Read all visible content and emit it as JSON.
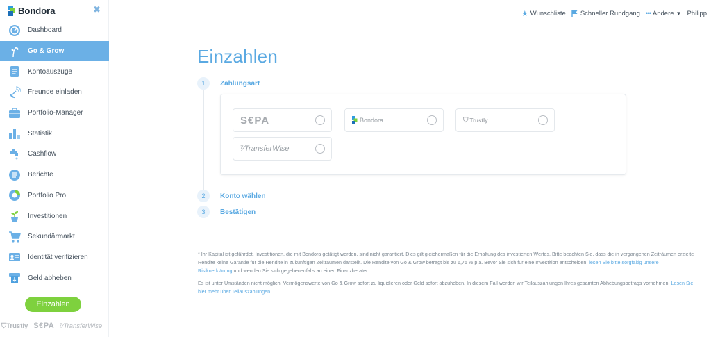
{
  "brand": {
    "name": "Bondora"
  },
  "sidebar": {
    "items": [
      {
        "label": "Dashboard",
        "icon": "dashboard-icon",
        "active": false
      },
      {
        "label": "Go & Grow",
        "icon": "go-grow-icon",
        "active": true
      },
      {
        "label": "Kontoauszüge",
        "icon": "statement-icon",
        "active": false
      },
      {
        "label": "Freunde einladen",
        "icon": "invite-satellite-icon",
        "active": false
      },
      {
        "label": "Portfolio-Manager",
        "icon": "briefcase-icon",
        "active": false
      },
      {
        "label": "Statistik",
        "icon": "bar-chart-icon",
        "active": false
      },
      {
        "label": "Cashflow",
        "icon": "faucet-icon",
        "active": false
      },
      {
        "label": "Berichte",
        "icon": "report-icon",
        "active": false
      },
      {
        "label": "Portfolio Pro",
        "icon": "pie-chart-icon",
        "active": false
      },
      {
        "label": "Investitionen",
        "icon": "plant-icon",
        "active": false
      },
      {
        "label": "Sekundärmarkt",
        "icon": "cart-icon",
        "active": false
      },
      {
        "label": "Identität verifizieren",
        "icon": "id-card-icon",
        "active": false
      },
      {
        "label": "Geld abheben",
        "icon": "withdraw-icon",
        "active": false
      }
    ],
    "deposit_button": "Einzahlen",
    "footer_logos": {
      "trustly": "Trustly",
      "sepa": "S€PA",
      "transferwise": "TransferWise"
    }
  },
  "topbar": {
    "wishlist": "Wunschliste",
    "tour": "Schneller Rundgang",
    "other": "Andere",
    "user": "Philipp"
  },
  "main": {
    "title": "Einzahlen",
    "steps": [
      {
        "num": "1",
        "label": "Zahlungsart"
      },
      {
        "num": "2",
        "label": "Konto wählen"
      },
      {
        "num": "3",
        "label": "Bestätigen"
      }
    ],
    "payment_options": {
      "sepa": "S€PA",
      "bondora": "Bondora",
      "trustly": "Trustly",
      "transferwise": "TransferWise"
    },
    "disclaimer": {
      "p1_text_a": "* Ihr Kapital ist gefährdet. Investitionen, die mit Bondora getätigt werden, sind nicht garantiert. Dies gilt gleichermaßen für die Erhaltung des investierten Wertes. Bitte beachten Sie, dass die in vergangenen Zeiträumen erzielte Rendite keine Garantie für die Rendite in zukünftigen Zeiträumen darstellt. Die Rendite von Go & Grow beträgt bis zu 6,75 % p.a. Bevor Sie sich für eine Investition entscheiden, ",
      "p1_link": "lesen Sie bitte sorgfältig unsere Risikoerklärung",
      "p1_text_b": " und wenden Sie sich gegebenenfalls an einen Finanzberater.",
      "p2_text": "Es ist unter Umständen nicht möglich, Vermögenswerte von Go & Grow sofort zu liquidieren oder Geld sofort abzuheben. In diesem Fall werden wir Teilauszahlungen Ihres gesamten Abhebungsbetrags vornehmen. ",
      "p2_link": "Lesen Sie hier mehr über Teilauszahlungen."
    }
  },
  "colors": {
    "accent": "#5aa9e2",
    "active_nav": "#6bb0e6",
    "cta": "#7ed13e"
  }
}
